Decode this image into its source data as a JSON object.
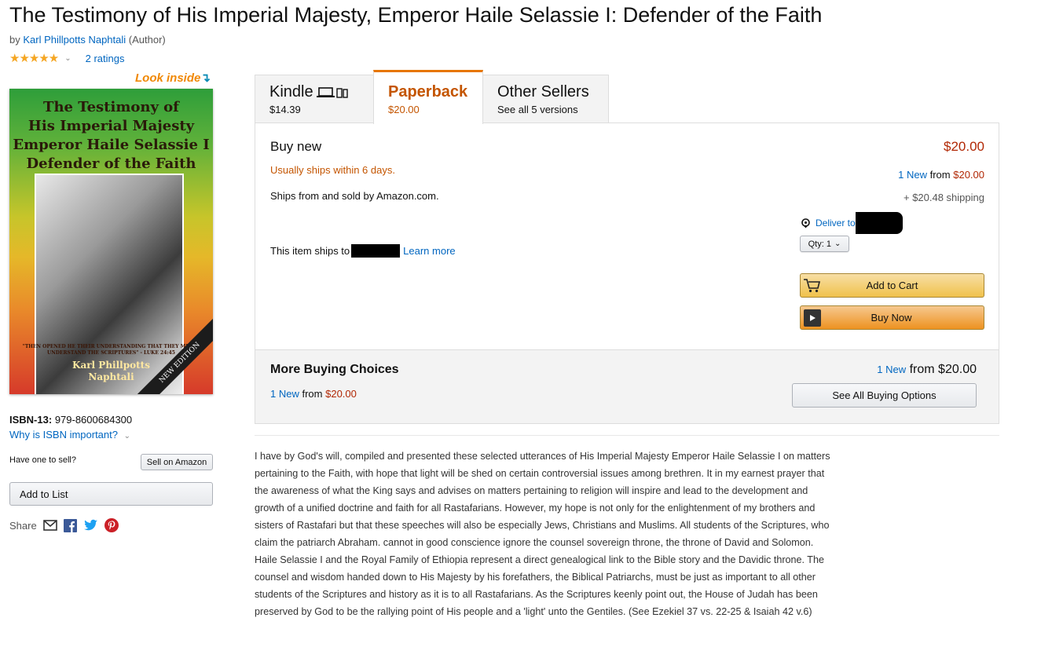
{
  "product": {
    "title": "The Testimony of His Imperial Majesty, Emperor Haile Selassie I: Defender of the Faith",
    "by": "by",
    "author": "Karl Phillpotts Naphtali",
    "author_role": "(Author)",
    "stars": "★★★★★",
    "ratings": "2 ratings"
  },
  "cover": {
    "look_inside": "Look inside",
    "title_lines": [
      "The Testimony of",
      "His Imperial Majesty",
      "Emperor Haile Selassie I",
      "Defender of the Faith"
    ],
    "quote": "\"THEN OPENED HE THEIR UNDERSTANDING THAT THEY MIGHT UNDERSTAND THE SCRIPTURES\" - LUKE 24:45",
    "author_lines": [
      "Karl Phillpotts",
      "Naphtali"
    ],
    "ribbon": "NEW EDITION"
  },
  "left": {
    "isbn_label": "ISBN-13:",
    "isbn_value": "979-8600684300",
    "isbn_why": "Why is ISBN important?",
    "sell_label": "Have one to sell?",
    "sell_button": "Sell on Amazon",
    "add_list": "Add to List",
    "share": "Share"
  },
  "tabs": [
    {
      "name": "Kindle",
      "price": "$14.39"
    },
    {
      "name": "Paperback",
      "price": "$20.00"
    },
    {
      "name": "Other Sellers",
      "price": "See all 5 versions"
    }
  ],
  "buybox": {
    "buy_new": "Buy new",
    "price": "$20.00",
    "ships_within": "Usually ships within 6 days.",
    "ships_from": "Ships from and sold by Amazon.com.",
    "ships_to": "This item ships to",
    "learn_more": "Learn more",
    "new_count": "1 New",
    "new_from": "from",
    "new_price": "$20.00",
    "shipping": "+ $20.48 shipping",
    "deliver_to": "Deliver to",
    "qty": "Qty: 1",
    "add_to_cart": "Add to Cart",
    "buy_now": "Buy Now"
  },
  "more": {
    "title": "More Buying Choices",
    "count": "1 New",
    "from": "from",
    "price": "$20.00",
    "right_count": "1 New",
    "right_from": "from $20.00",
    "see_all": "See All Buying Options"
  },
  "description": "I have by God's will, compiled and presented these selected utterances of His Imperial Majesty Emperor Haile Selassie I on matters pertaining to the Faith, with hope that light will be shed on certain controversial issues among brethren. It in my earnest prayer that the awareness of what the King says and advises on matters pertaining to religion will inspire and lead to the development and growth of a unified doctrine and faith for all Rastafarians. However, my hope is not only for the enlightenment of my brothers and sisters of Rastafari but that these speeches will also be especially Jews, Christians and Muslims. All students of the Scriptures, who claim the patriarch Abraham. cannot in good conscience ignore the counsel sovereign throne, the throne of David and Solomon. Haile Selassie I and the Royal Family of Ethiopia represent a direct genealogical link to the Bible story and the Davidic throne. The counsel and wisdom handed down to His Majesty by his forefathers, the Biblical Patriarchs, must be just as important to all other students of the Scriptures and history as it is to all Rastafarians. As the Scriptures keenly point out, the House of Judah has been preserved by God to be the rallying point of His people and a 'light' unto the Gentiles. (See Ezekiel 37 vs. 22-25 & Isaiah 42 v.6)",
  "colors": {
    "link": "#0066c0",
    "price": "#b12704",
    "accent": "#c45500",
    "star": "#f5a623",
    "button_yellow": "#f0c14b",
    "button_orange": "#ed9220"
  }
}
